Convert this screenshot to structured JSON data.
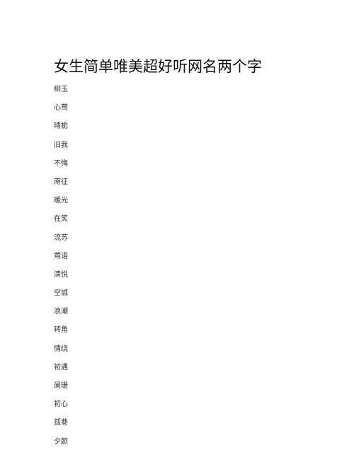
{
  "document": {
    "title": "女生简单唯美超好听网名两个字",
    "names": [
      "柳玉",
      "心莺",
      "晴栀",
      "旧我",
      "不悔",
      "南征",
      "暖光",
      "在笑",
      "流苏",
      "莺语",
      "清悦",
      "空城",
      "浪潮",
      "转角",
      "情绕",
      "初遇",
      "阑珊",
      "初心",
      "孤巷",
      "夕颜"
    ]
  }
}
